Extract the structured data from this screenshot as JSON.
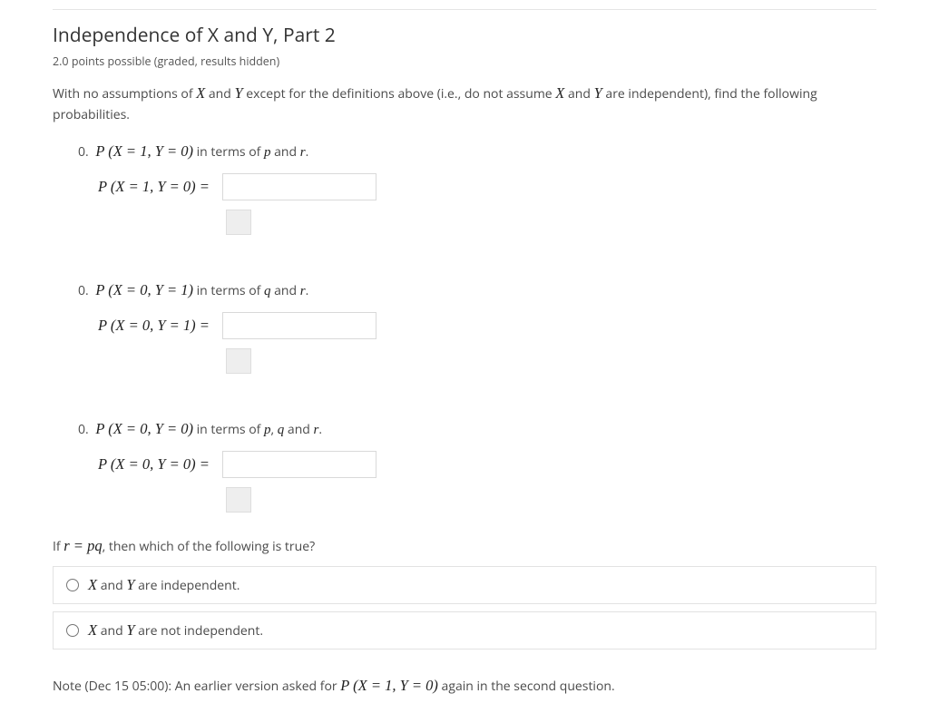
{
  "title": "Independence of X and Y, Part 2",
  "points": "2.0 points possible (graded, results hidden)",
  "intro_pre": "With no assumptions of ",
  "intro_mid1": " and ",
  "intro_mid2": " except for the definitions above (i.e., do not assume ",
  "intro_mid3": " and ",
  "intro_end": " are independent), find the following probabilities.",
  "X": "X",
  "Y": "Y",
  "q1": {
    "num": "0.",
    "expr": "P (X = 1, Y = 0)",
    "tail_pre": " in terms of ",
    "v1": "p",
    "and": " and ",
    "v2": "r",
    "period": ".",
    "label": "P (X = 1, Y = 0) ="
  },
  "q2": {
    "num": "0.",
    "expr": "P (X = 0, Y = 1)",
    "tail_pre": " in terms of ",
    "v1": "q",
    "and": " and ",
    "v2": "r",
    "period": ".",
    "label": "P (X = 0, Y = 1) ="
  },
  "q3": {
    "num": "0.",
    "expr": "P (X = 0, Y = 0)",
    "tail_pre": " in terms of ",
    "v1": "p",
    "c1": ", ",
    "v2": "q",
    "and": " and ",
    "v3": "r",
    "period": ".",
    "label": "P (X = 0, Y = 0) ="
  },
  "mc": {
    "pre": "If ",
    "expr": "r = pq",
    "post": ", then which of the following is true?",
    "opt1_mid": " and ",
    "opt1_end": " are independent.",
    "opt2_mid": " and ",
    "opt2_end": " are not independent."
  },
  "note": {
    "pre": "Note (Dec 15 05:00): An earlier version asked for ",
    "expr": "P (X = 1, Y = 0)",
    "post": " again in the second question."
  }
}
